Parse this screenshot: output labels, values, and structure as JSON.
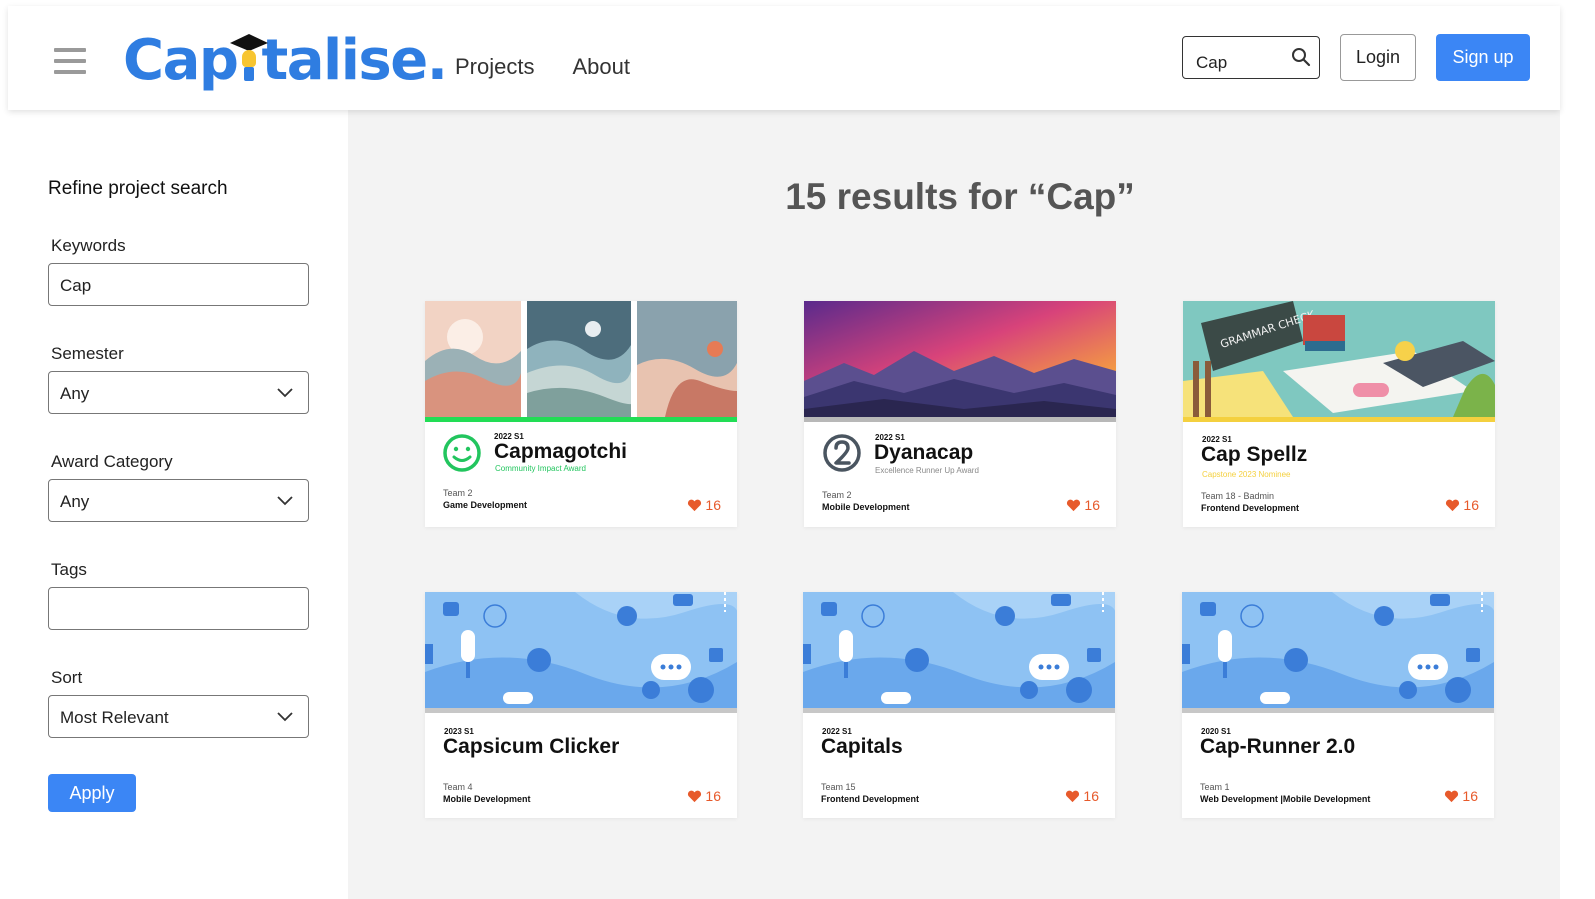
{
  "header": {
    "logo_left": "Cap",
    "logo_right": "talise.",
    "nav": [
      "Projects",
      "About"
    ],
    "search_value": "Cap",
    "login": "Login",
    "signup": "Sign up"
  },
  "sidebar": {
    "title": "Refine project search",
    "keywords_label": "Keywords",
    "keywords_value": "Cap",
    "semester_label": "Semester",
    "semester_value": "Any",
    "award_label": "Award Category",
    "award_value": "Any",
    "tags_label": "Tags",
    "tags_value": "",
    "sort_label": "Sort",
    "sort_value": "Most Relevant",
    "apply": "Apply"
  },
  "main": {
    "results_title": "15 results for “Cap”",
    "cards": [
      {
        "semester": "2022 S1",
        "title": "Capmagotchi",
        "award": "Community Impact Award",
        "team": "Team 2",
        "category": "Game Development",
        "likes": "16"
      },
      {
        "semester": "2022 S1",
        "title": "Dyanacap",
        "award": "Excellence Runner Up Award",
        "team": "Team 2",
        "category": "Mobile Development",
        "likes": "16"
      },
      {
        "semester": "2022 S1",
        "title": "Cap Spellz",
        "award": "Capstone 2023 Nominee",
        "team": "Team 18 - Badmin",
        "category": "Frontend Development",
        "likes": "16"
      },
      {
        "semester": "2023 S1",
        "title": "Capsicum Clicker",
        "award": "",
        "team": "Team 4",
        "category": "Mobile Development",
        "likes": "16"
      },
      {
        "semester": "2022 S1",
        "title": "Capitals",
        "award": "",
        "team": "Team 15",
        "category": "Frontend Development",
        "likes": "16"
      },
      {
        "semester": "2020 S1",
        "title": "Cap-Runner 2.0",
        "award": "",
        "team": "Team 1",
        "category": "Web Development |Mobile Development",
        "likes": "16"
      }
    ]
  },
  "thumb_texts": {
    "grammar": "GRAMMAR CHECK"
  },
  "colors": {
    "brand_blue": "#2f7de1",
    "button_blue": "#3b86f5",
    "like_orange": "#e75a2b",
    "award_green": "#22c55e",
    "award_gray": "#8a8a8a",
    "award_yellow": "#f4d03f"
  },
  "icons": {
    "menu": "hamburger-icon",
    "search": "search-icon",
    "chevron": "chevron-down-icon",
    "like": "heart-icon",
    "award_smile": "smile-icon",
    "award_runner_up": "number-two-icon"
  }
}
